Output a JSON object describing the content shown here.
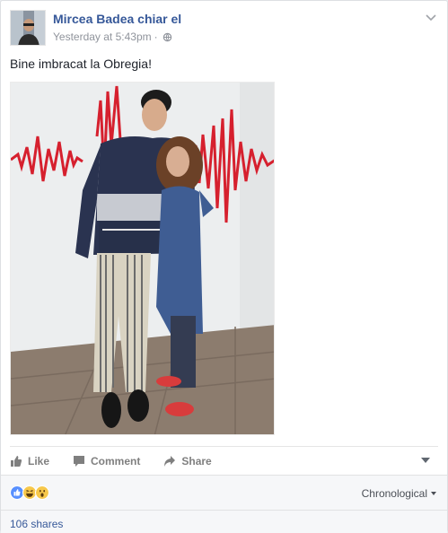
{
  "post": {
    "author": "Mircea Badea chiar el",
    "timestamp": "Yesterday at 5:43pm",
    "separator": "·",
    "privacy_icon": "public-globe-icon",
    "text": "Bine imbracat la Obregia!"
  },
  "actions": {
    "like": "Like",
    "comment": "Comment",
    "share": "Share"
  },
  "reactions": {
    "icons": [
      "like-reaction-icon",
      "haha-reaction-icon",
      "wow-reaction-icon"
    ],
    "sort_label": "Chronological"
  },
  "footer": {
    "shares": "106 shares"
  },
  "colors": {
    "link": "#365899",
    "muted": "#90949c",
    "like_blue": "#5890ff",
    "emoji_yellow": "#f7c84b",
    "wave_red": "#d6202e"
  }
}
